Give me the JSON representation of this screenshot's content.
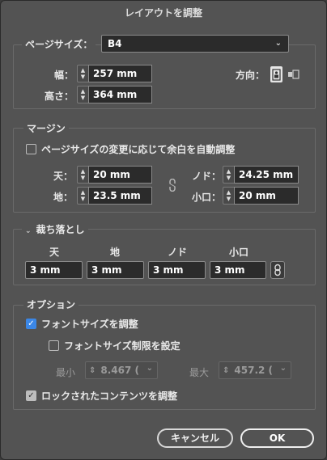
{
  "title": "レイアウトを調整",
  "page_size": {
    "label": "ページサイズ：",
    "value": "B4"
  },
  "width": {
    "label": "幅：",
    "value": "257 mm"
  },
  "height": {
    "label": "高さ：",
    "value": "364 mm"
  },
  "orientation": {
    "label": "方向：",
    "portrait_icon": "portrait-icon",
    "landscape_icon": "landscape-icon"
  },
  "margins": {
    "title": "マージン",
    "adjust_label": "ページサイズの変更に応じて余白を自動調整",
    "adjust_checked": false,
    "top": {
      "label": "天：",
      "value": "20 mm"
    },
    "bottom": {
      "label": "地：",
      "value": "23.5 mm"
    },
    "inside": {
      "label": "ノド：",
      "value": "24.25 mm"
    },
    "outside": {
      "label": "小口：",
      "value": "20 mm"
    },
    "link_icon": "broken-chain-icon"
  },
  "bleed": {
    "title": "裁ち落とし",
    "columns": [
      "天",
      "地",
      "ノド",
      "小口"
    ],
    "values": [
      "3 mm",
      "3 mm",
      "3 mm",
      "3 mm"
    ],
    "link_icon": "chain-link-icon"
  },
  "options": {
    "title": "オプション",
    "adjust_fonts_label": "フォントサイズを調整",
    "adjust_fonts_checked": true,
    "font_limit_label": "フォントサイズ制限を設定",
    "font_limit_checked": false,
    "min_label": "最小",
    "min_value": "8.467 (",
    "max_label": "最大",
    "max_value": "457.2 (",
    "locked_label": "ロックされたコンテンツを調整",
    "locked_checked": true
  },
  "buttons": {
    "cancel": "キャンセル",
    "ok": "OK"
  },
  "colors": {
    "accent": "#3b87e6",
    "panel": "#535353",
    "field": "#2b2b2b"
  }
}
